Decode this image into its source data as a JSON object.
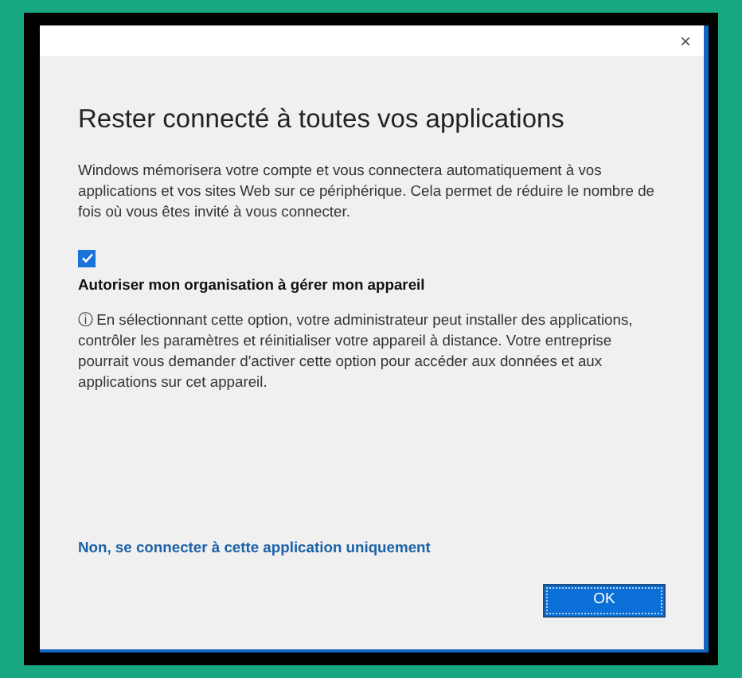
{
  "window": {
    "close": "×"
  },
  "title": "Rester connecté à toutes vos applications",
  "description": "Windows mémorisera votre compte et vous connectera automatiquement à vos applications et vos sites Web sur ce périphérique. Cela permet de réduire le nombre de fois où vous êtes invité à vous connecter.",
  "checkbox": {
    "checked": true,
    "label": "Autoriser mon organisation à gérer mon appareil"
  },
  "info": "ⓘ En sélectionnant cette option, votre administrateur peut installer des applications, contrôler les paramètres et réinitialiser votre appareil à distance. Votre entreprise pourrait vous demander d'activer cette option pour accéder aux données et aux applications sur cet appareil.",
  "link": "Non, se connecter à cette application uniquement",
  "buttons": [
    "OK"
  ]
}
